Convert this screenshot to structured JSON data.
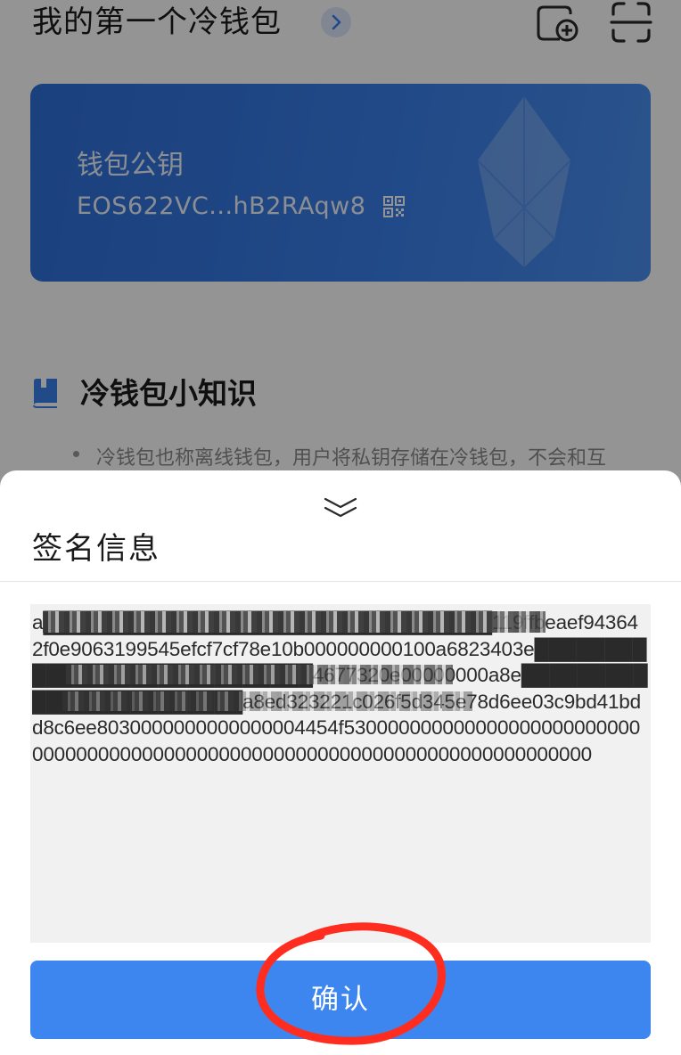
{
  "header": {
    "wallet_title": "我的第一个冷钱包",
    "icons": [
      "chevron-right-icon",
      "add-wallet-icon",
      "scan-icon"
    ]
  },
  "card": {
    "label": "钱包公钥",
    "public_key": "EOS622VC...hB2RAqw8",
    "accent": "#3a80ea"
  },
  "tips": {
    "title": "冷钱包小知识",
    "first_tip": "冷钱包也称离线钱包，用户将私钥存储在冷钱包，不会和互"
  },
  "sheet": {
    "title": "签名信息",
    "signature_text": "a████████████████████████████████119ffbeaef943642f0e9063199545efcf7cf78e10b000000000100a6823403e████████████████████████████4677320e00000000a8e████████████████████████a8ed323221c026f5d345e78d6ee03c9bd41bdd8c6ee8030000000000000004454f530000000000000000000000000000000000000000000000000000000000000000000000000000",
    "confirm_label": "确认",
    "confirm_color": "#3d86ef",
    "annotation_color": "#ff2d1f"
  }
}
